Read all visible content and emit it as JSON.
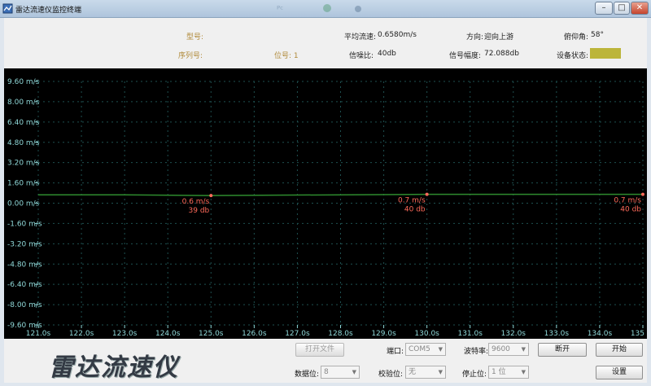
{
  "window": {
    "title": "雷达流速仪监控终端",
    "minimize": "–",
    "maximize": "□",
    "close": "✕"
  },
  "info": {
    "model_label": "型号:",
    "model_value": "",
    "serial_label": "序列号:",
    "serial_value": "",
    "position_text": "位号: 1",
    "avg_speed_label": "平均流速:",
    "avg_speed_value": "0.6580m/s",
    "snr_label": "信噪比:",
    "snr_value": "40db",
    "direction_label": "方向:",
    "direction_value": "迎向上游",
    "amplitude_label": "信号幅度:",
    "amplitude_value": "72.088db",
    "pitch_label": "俯仰角:",
    "pitch_value": "58°",
    "status_label": "设备状态:",
    "status_color": "#bcb53a"
  },
  "chart_data": {
    "type": "line",
    "title": "",
    "xlabel": "",
    "ylabel": "",
    "y_ticks": [
      "9.60 m/s",
      "8.00 m/s",
      "6.40 m/s",
      "4.80 m/s",
      "3.20 m/s",
      "1.60 m/s",
      "0.00 m/s",
      "-1.60 m/s",
      "-3.20 m/s",
      "-4.80 m/s",
      "-6.40 m/s",
      "-8.00 m/s",
      "-9.60 m/s"
    ],
    "x_ticks": [
      "121.0s",
      "122.0s",
      "123.0s",
      "124.0s",
      "125.0s",
      "126.0s",
      "127.0s",
      "128.0s",
      "129.0s",
      "130.0s",
      "131.0s",
      "132.0s",
      "133.0s",
      "134.0s",
      "135"
    ],
    "xlim": [
      121,
      135
    ],
    "ylim": [
      -9.6,
      9.6
    ],
    "grid": true,
    "series": [
      {
        "x": [
          121,
          123.0,
          125.0,
          130.0,
          135.0
        ],
        "y": [
          0.66,
          0.66,
          0.6,
          0.7,
          0.7
        ],
        "color": "#2e8b2e"
      }
    ],
    "annotations": [
      {
        "x": 125.0,
        "y": 0.6,
        "speed": "0.6 m/s",
        "snr": "39 db"
      },
      {
        "x": 130.0,
        "y": 0.7,
        "speed": "0.7 m/s",
        "snr": "40 db"
      },
      {
        "x": 135.0,
        "y": 0.7,
        "speed": "0.7 m/s",
        "snr": "40 db"
      }
    ],
    "colors": {
      "tick": "#8fd8d8",
      "grid": "#1e5050",
      "annotation": "#ff6a5a",
      "point": "#ff6a5a"
    }
  },
  "controls": {
    "logo": "雷达流速仪",
    "open_file": "打开文件",
    "port_label": "端口:",
    "port_value": "COM5",
    "baud_label": "波特率:",
    "baud_value": "9600",
    "disconnect": "断开",
    "start": "开始",
    "databits_label": "数据位:",
    "databits_value": "8",
    "parity_label": "校验位:",
    "parity_value": "无",
    "stopbits_label": "停止位:",
    "stopbits_value": "1 位",
    "settings": "设置"
  }
}
